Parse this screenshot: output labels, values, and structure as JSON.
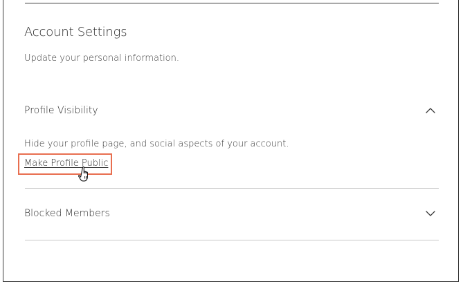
{
  "account_settings": {
    "title": "Account Settings",
    "subtitle": "Update your personal information."
  },
  "profile_visibility": {
    "label": "Profile Visibility",
    "expanded": true,
    "chevron_icon": "chevron-up-icon",
    "description": "Hide your profile page, and social aspects of your account.",
    "action_label": "Make Profile Public",
    "highlight_color": "#e86e4f"
  },
  "blocked_members": {
    "label": "Blocked Members",
    "expanded": false,
    "chevron_icon": "chevron-down-icon"
  },
  "cursor_icon": "hand-pointer-cursor-icon"
}
